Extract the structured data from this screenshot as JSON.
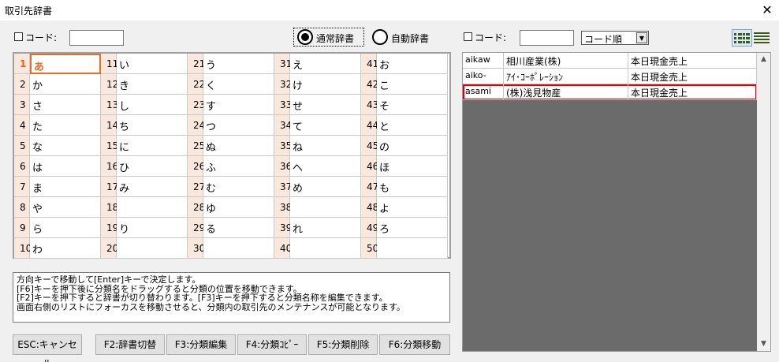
{
  "window": {
    "title": "取引先辞書",
    "close_glyph": "✕"
  },
  "left": {
    "code_label": "コード:",
    "code_value": "",
    "radio_normal": "通常辞書",
    "radio_auto": "自動辞書",
    "radio_selected": "通常辞書",
    "grid": [
      [
        {
          "n": "1",
          "k": "あ"
        },
        {
          "n": "11",
          "k": "い"
        },
        {
          "n": "21",
          "k": "う"
        },
        {
          "n": "31",
          "k": "え"
        },
        {
          "n": "41",
          "k": "お"
        }
      ],
      [
        {
          "n": "2",
          "k": "か"
        },
        {
          "n": "12",
          "k": "き"
        },
        {
          "n": "22",
          "k": "く"
        },
        {
          "n": "32",
          "k": "け"
        },
        {
          "n": "42",
          "k": "こ"
        }
      ],
      [
        {
          "n": "3",
          "k": "さ"
        },
        {
          "n": "13",
          "k": "し"
        },
        {
          "n": "23",
          "k": "す"
        },
        {
          "n": "33",
          "k": "せ"
        },
        {
          "n": "43",
          "k": "そ"
        }
      ],
      [
        {
          "n": "4",
          "k": "た"
        },
        {
          "n": "14",
          "k": "ち"
        },
        {
          "n": "24",
          "k": "つ"
        },
        {
          "n": "34",
          "k": "て"
        },
        {
          "n": "44",
          "k": "と"
        }
      ],
      [
        {
          "n": "5",
          "k": "な"
        },
        {
          "n": "15",
          "k": "に"
        },
        {
          "n": "25",
          "k": "ぬ"
        },
        {
          "n": "35",
          "k": "ね"
        },
        {
          "n": "45",
          "k": "の"
        }
      ],
      [
        {
          "n": "6",
          "k": "は"
        },
        {
          "n": "16",
          "k": "ひ"
        },
        {
          "n": "26",
          "k": "ふ"
        },
        {
          "n": "36",
          "k": "へ"
        },
        {
          "n": "46",
          "k": "ほ"
        }
      ],
      [
        {
          "n": "7",
          "k": "ま"
        },
        {
          "n": "17",
          "k": "み"
        },
        {
          "n": "27",
          "k": "む"
        },
        {
          "n": "37",
          "k": "め"
        },
        {
          "n": "47",
          "k": "も"
        }
      ],
      [
        {
          "n": "8",
          "k": "や"
        },
        {
          "n": "18",
          "k": ""
        },
        {
          "n": "28",
          "k": "ゆ"
        },
        {
          "n": "38",
          "k": ""
        },
        {
          "n": "48",
          "k": "よ"
        }
      ],
      [
        {
          "n": "9",
          "k": "ら"
        },
        {
          "n": "19",
          "k": "り"
        },
        {
          "n": "29",
          "k": "る"
        },
        {
          "n": "39",
          "k": "れ"
        },
        {
          "n": "49",
          "k": "ろ"
        }
      ],
      [
        {
          "n": "10",
          "k": "わ"
        },
        {
          "n": "20",
          "k": ""
        },
        {
          "n": "30",
          "k": ""
        },
        {
          "n": "40",
          "k": ""
        },
        {
          "n": "50",
          "k": ""
        }
      ]
    ],
    "selected_cell": "1",
    "help_lines": [
      "方向キーで移動して[Enter]キーで決定します。",
      "[F6]キーを押下後に分類名をドラッグすると分類の位置を移動できます。",
      "[F2]キーを押下すると辞書が切り替わります。[F3]キーを押下すると分類名称を編集できます。",
      "画面右側のリストにフォーカスを移動させると、分類内の取引先のメンテナンスが可能となります。"
    ],
    "buttons": {
      "esc": "ESC:キャンセル",
      "f2": "F2:辞書切替",
      "f3": "F3:分類編集",
      "f4": "F4:分類ｺﾋﾟｰ",
      "f5": "F5:分類削除",
      "f6": "F6:分類移動"
    }
  },
  "right": {
    "code_label": "コード:",
    "code_value": "",
    "sort_selected": "コード順",
    "view_icons": [
      "grid-view-icon",
      "list-view-icon"
    ],
    "rows": [
      {
        "code": "aikaw",
        "name": "相川産業(株)",
        "note": "本日現金売上"
      },
      {
        "code": "aiko-",
        "name": "ｱｲ･ｺｰﾎﾟﾚｰｼｮﾝ",
        "note": "本日現金売上"
      },
      {
        "code": "asami",
        "name": "(株)浅見物産",
        "note": "本日現金売上"
      }
    ],
    "selected_row": 2
  },
  "colors": {
    "grid_num_bg": "#fbe8dc",
    "selection_orange": "#e0702a",
    "row_selection_red": "#e0000a",
    "list_background": "#6b6b6b"
  }
}
